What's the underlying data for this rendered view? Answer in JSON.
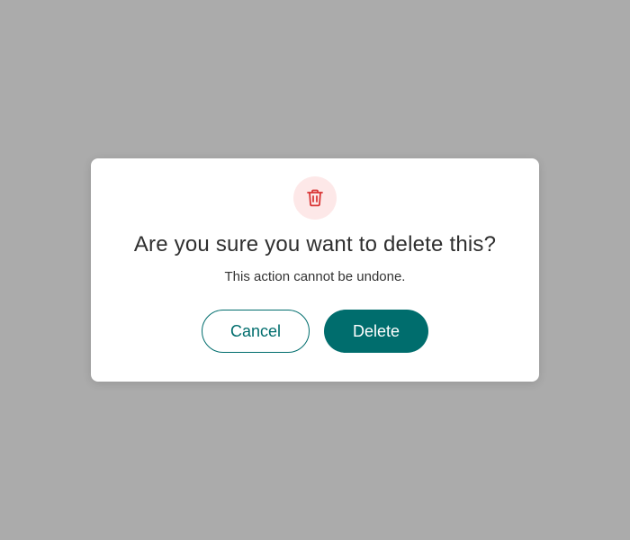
{
  "dialog": {
    "icon": "trash-icon",
    "title": "Are you sure you want to delete this?",
    "message": "This action cannot be undone.",
    "cancel_label": "Cancel",
    "delete_label": "Delete"
  },
  "colors": {
    "overlay": "#ababab",
    "accent": "#006d6d",
    "danger": "#d93636",
    "danger_bg": "#fde8e8"
  }
}
